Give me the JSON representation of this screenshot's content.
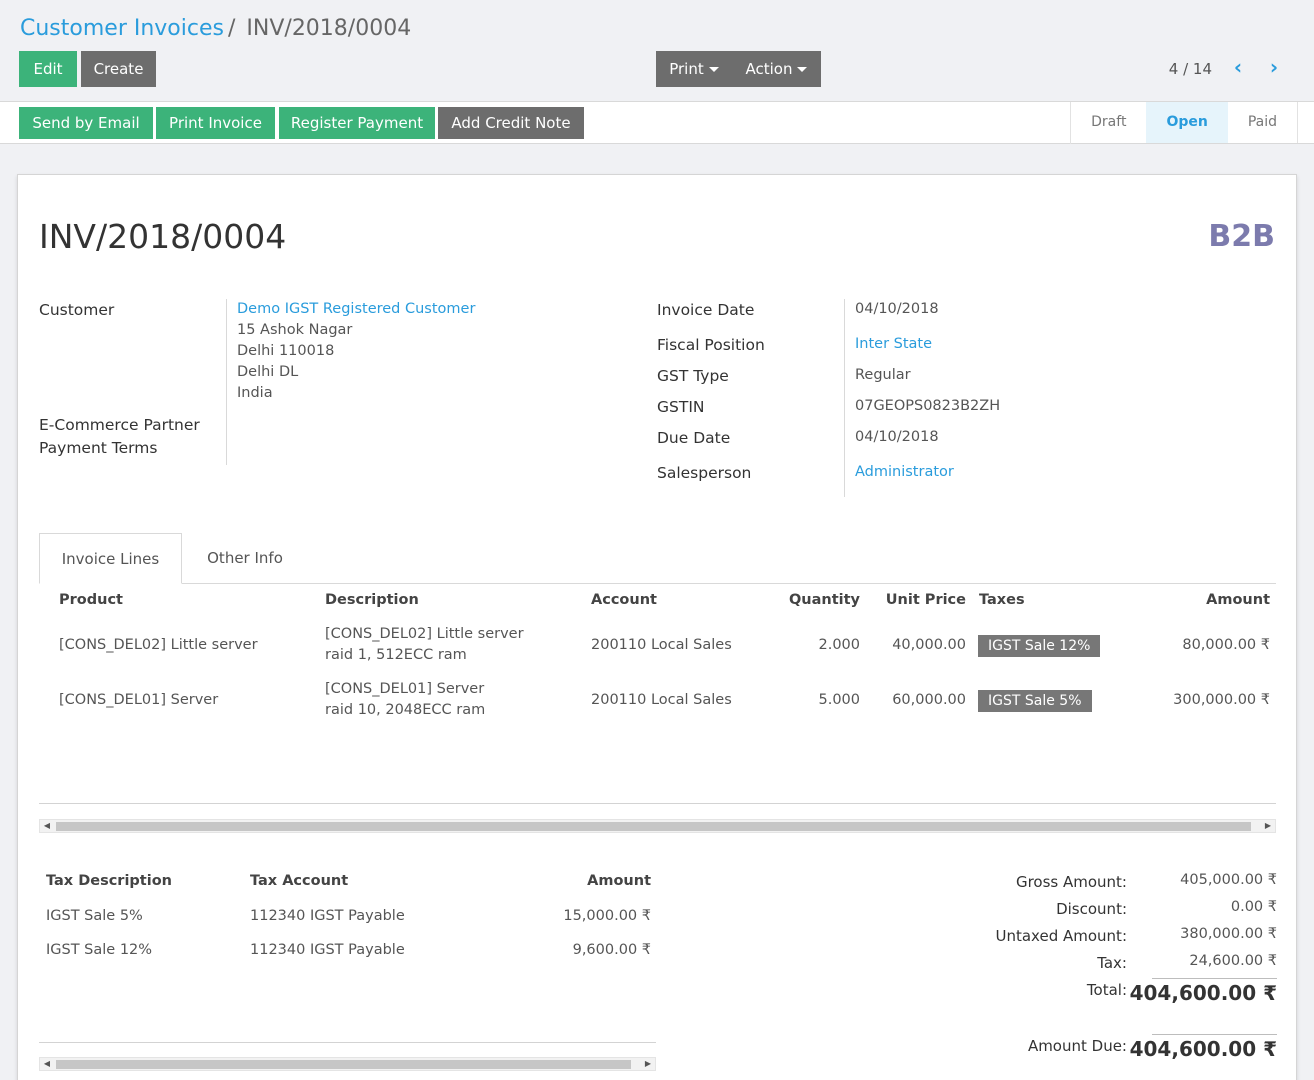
{
  "breadcrumb": {
    "parent": "Customer Invoices",
    "separator": "/",
    "current": "INV/2018/0004"
  },
  "toolbar": {
    "edit": "Edit",
    "create": "Create",
    "print": "Print",
    "action": "Action"
  },
  "pager": {
    "value": "4 / 14",
    "prev_icon": "chevron-left-icon",
    "next_icon": "chevron-right-icon"
  },
  "status_buttons": {
    "send_email": "Send by Email",
    "print_invoice": "Print Invoice",
    "register_payment": "Register Payment",
    "add_credit_note": "Add Credit Note"
  },
  "states": {
    "draft": "Draft",
    "open": "Open",
    "paid": "Paid",
    "active": "Open"
  },
  "invoice": {
    "number": "INV/2018/0004",
    "type_badge": "B2B",
    "labels": {
      "customer": "Customer",
      "ecommerce": "E-Commerce Partner",
      "payment_terms": "Payment Terms",
      "invoice_date": "Invoice Date",
      "fiscal_position": "Fiscal Position",
      "gst_type": "GST Type",
      "gstin": "GSTIN",
      "due_date": "Due Date",
      "salesperson": "Salesperson"
    },
    "customer": {
      "name": "Demo IGST Registered Customer",
      "address1": "15 Ashok Nagar",
      "address2": "Delhi 110018",
      "address3": "Delhi DL",
      "country": "India"
    },
    "invoice_date": "04/10/2018",
    "fiscal_position": "Inter State",
    "gst_type": "Regular",
    "gstin": "07GEOPS0823B2ZH",
    "due_date": "04/10/2018",
    "salesperson": "Administrator"
  },
  "tabs": {
    "lines": "Invoice Lines",
    "other": "Other Info"
  },
  "lines": {
    "headers": {
      "product": "Product",
      "description": "Description",
      "account": "Account",
      "quantity": "Quantity",
      "unit_price": "Unit Price",
      "taxes": "Taxes",
      "amount": "Amount"
    },
    "rows": [
      {
        "product": "[CONS_DEL02] Little server",
        "desc1": "[CONS_DEL02] Little server",
        "desc2": "raid 1, 512ECC ram",
        "account": "200110 Local Sales",
        "quantity": "2.000",
        "unit_price": "40,000.00",
        "tax": "IGST Sale 12%",
        "amount": "80,000.00 ₹"
      },
      {
        "product": "[CONS_DEL01] Server",
        "desc1": "[CONS_DEL01] Server",
        "desc2": "raid 10, 2048ECC ram",
        "account": "200110 Local Sales",
        "quantity": "5.000",
        "unit_price": "60,000.00",
        "tax": "IGST Sale 5%",
        "amount": "300,000.00 ₹"
      }
    ]
  },
  "tax_table": {
    "headers": {
      "description": "Tax Description",
      "account": "Tax Account",
      "amount": "Amount"
    },
    "rows": [
      {
        "description": "IGST Sale 5%",
        "account": "112340 IGST Payable",
        "amount": "15,000.00 ₹"
      },
      {
        "description": "IGST Sale 12%",
        "account": "112340 IGST Payable",
        "amount": "9,600.00 ₹"
      }
    ]
  },
  "totals": {
    "gross_label": "Gross Amount:",
    "gross": "405,000.00 ₹",
    "discount_label": "Discount:",
    "discount": "0.00 ₹",
    "untaxed_label": "Untaxed Amount:",
    "untaxed": "380,000.00 ₹",
    "tax_label": "Tax:",
    "tax": "24,600.00 ₹",
    "total_label": "Total:",
    "total": "404,600.00 ₹",
    "due_label": "Amount Due:",
    "due": "404,600.00 ₹"
  },
  "colors": {
    "primary_green": "#3cb37a",
    "secondary_gray": "#6d6d6d",
    "link_blue": "#2a9cdc",
    "badge_purple": "#7c7bad"
  }
}
